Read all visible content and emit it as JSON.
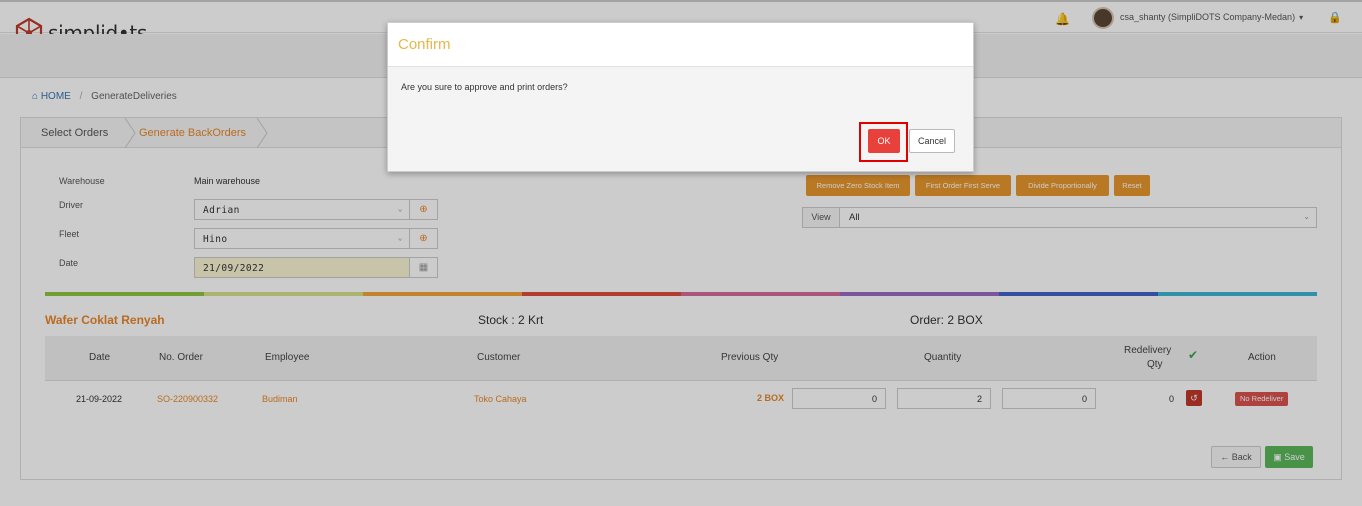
{
  "nav": {
    "brand": "simplid•ts",
    "user": "csa_shanty (SimpliDOTS Company-Medan)"
  },
  "breadcrumb": {
    "home": "HOME",
    "current": "GenerateDeliveries"
  },
  "wizard": {
    "step1": "Select Orders",
    "step2": "Generate BackOrders"
  },
  "form": {
    "warehouse_label": "Warehouse",
    "warehouse_value": "Main warehouse",
    "driver_label": "Driver",
    "driver_value": "Adrian",
    "fleet_label": "Fleet",
    "fleet_value": "Hino",
    "date_label": "Date",
    "date_value": "21/09/2022"
  },
  "actions": {
    "remove_zero": "Remove Zero Stock Item",
    "fofs": "First Order First Serve",
    "divide": "Divide Proportionally",
    "reset": "Reset",
    "view_label": "View",
    "view_value": "All"
  },
  "product": {
    "name": "Wafer Coklat Renyah",
    "stock": "Stock : 2 Krt",
    "order": "Order: 2 BOX"
  },
  "table": {
    "headers": {
      "date": "Date",
      "no_order": "No. Order",
      "employee": "Employee",
      "customer": "Customer",
      "previous_qty": "Previous Qty",
      "quantity": "Quantity",
      "redelivery_qty_1": "Redelivery",
      "redelivery_qty_2": "Qty",
      "action": "Action"
    },
    "rows": [
      {
        "date": "21-09-2022",
        "no_order": "SO-220900332",
        "employee": "Budiman",
        "customer": "Toko Cahaya",
        "previous_qty": "2 BOX",
        "qty1": "0",
        "qty2": "2",
        "qty3": "0",
        "redelivery_qty": "0",
        "action": "No Redeliver"
      }
    ]
  },
  "footer": {
    "back": "Back",
    "save": "Save"
  },
  "modal": {
    "title": "Confirm",
    "message": "Are you sure to approve and print orders?",
    "ok": "OK",
    "cancel": "Cancel"
  },
  "colors": {
    "accent": "#e8872a",
    "ok": "#e8413b",
    "save": "#5cb85c",
    "highlight": "#e00000",
    "modal_title": "#e6b84a"
  }
}
